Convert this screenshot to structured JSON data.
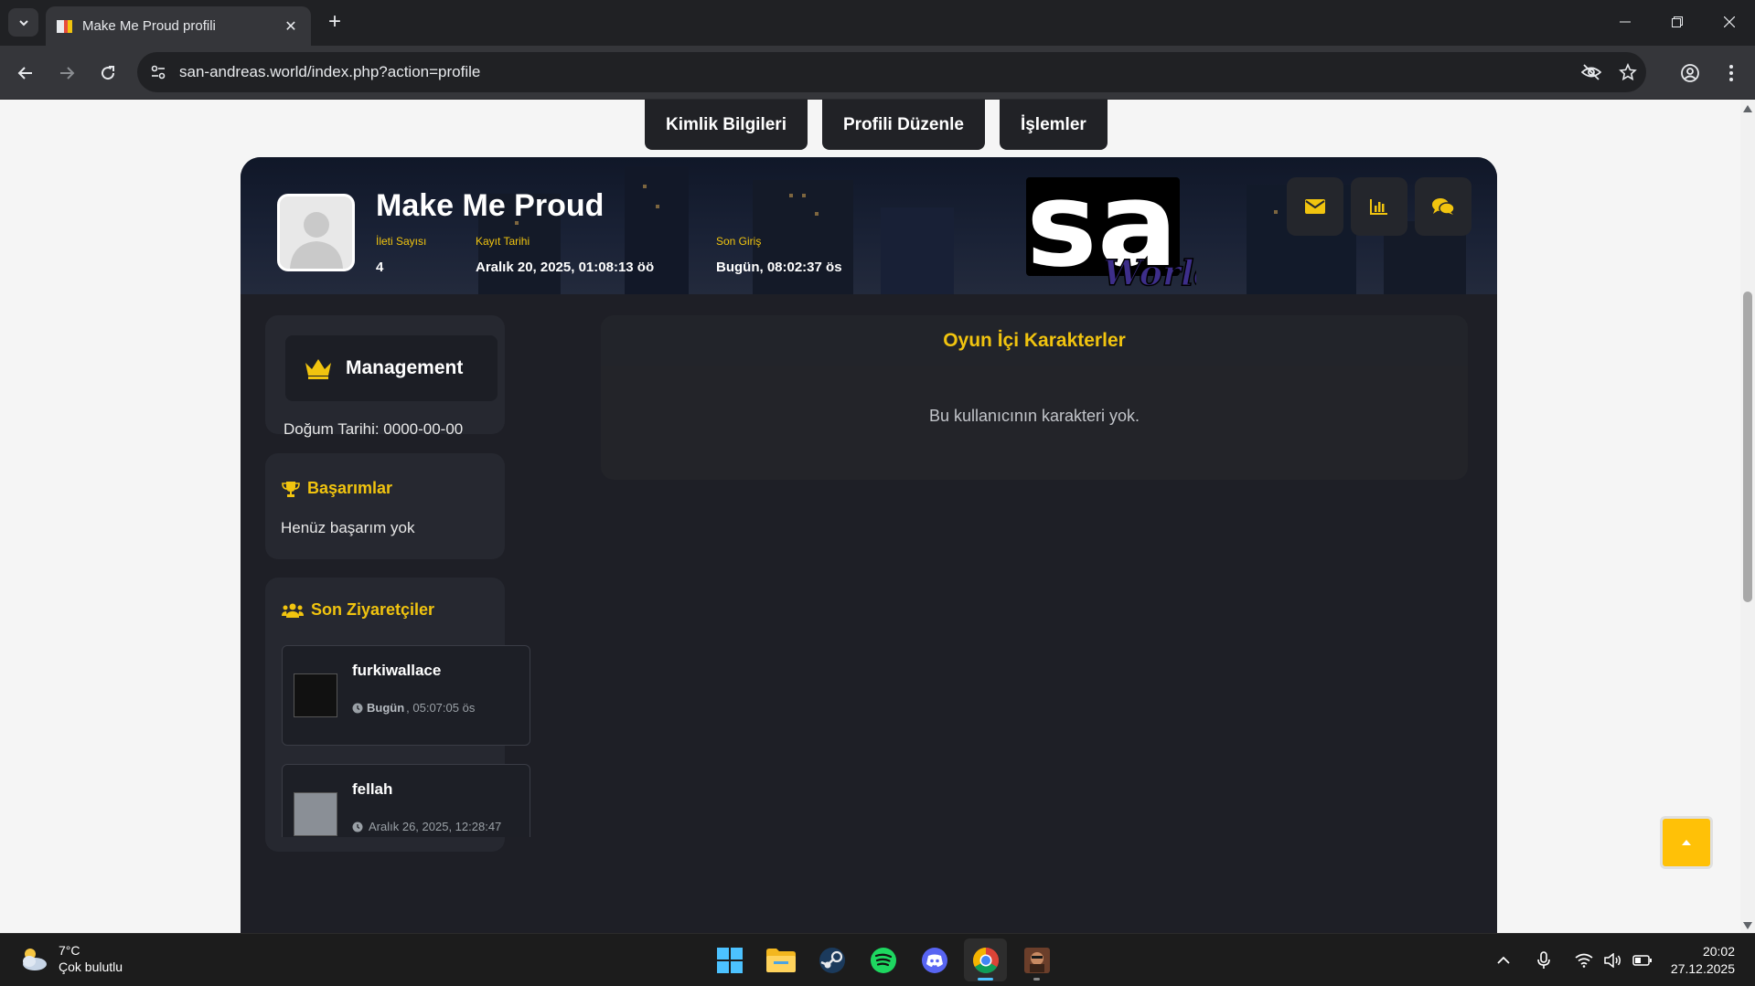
{
  "browser": {
    "tab_title": "Make Me Proud profili",
    "url": "san-andreas.world/index.php?action=profile"
  },
  "top_nav": [
    {
      "label": "Kimlik Bilgileri"
    },
    {
      "label": "Profili Düzenle"
    },
    {
      "label": "İşlemler"
    }
  ],
  "profile": {
    "username": "Make Me Proud",
    "stats": [
      {
        "label": "İleti Sayısı",
        "value": "4"
      },
      {
        "label": "Kayıt Tarihi",
        "value": "Aralık 20, 2025, 01:08:13 öö"
      },
      {
        "label": "Son Giriş",
        "value": "Bugün, 08:02:37 ös"
      }
    ],
    "logo_text": "sa",
    "logo_subtext": "World"
  },
  "sidebar": {
    "role": "Management",
    "birthdate": "Doğum Tarihi: 0000-00-00",
    "achievements_title": "Başarımlar",
    "achievements_empty": "Henüz başarım yok",
    "visitors_title": "Son Ziyaretçiler",
    "visitors": [
      {
        "name": "furkiwallace",
        "time_bold": "Bugün",
        "time_rest": ", 05:07:05 ös"
      },
      {
        "name": "fellah",
        "time_bold": "",
        "time_rest": "Aralık 26, 2025, 12:28:47"
      }
    ]
  },
  "characters": {
    "title": "Oyun İçi Karakterler",
    "empty": "Bu kullanıcının karakteri yok."
  },
  "taskbar": {
    "weather_temp": "7°C",
    "weather_desc": "Çok bulutlu",
    "time": "20:02",
    "date": "27.12.2025"
  },
  "colors": {
    "accent": "#f1c40f",
    "card_bg": "#1e1f26",
    "panel_bg": "#262830",
    "back_to_top": "#ffc107"
  }
}
